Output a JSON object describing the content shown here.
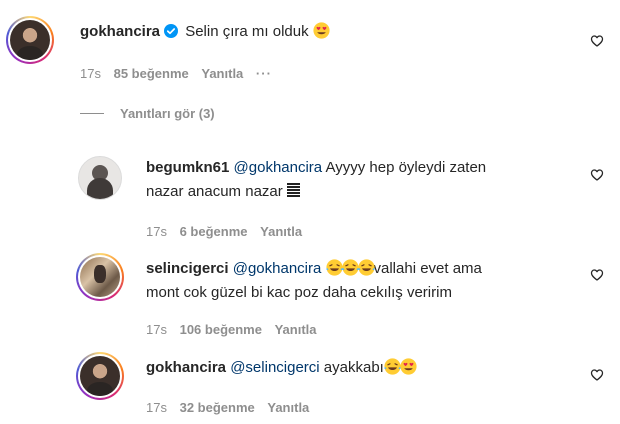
{
  "comments": [
    {
      "username": "gokhancira",
      "verified": true,
      "text": "Selin çıra mı olduk",
      "emoji": "heart-eyes-emoji",
      "time": "17s",
      "likes": "85 beğenme",
      "reply": "Yanıtla",
      "more": "···"
    }
  ],
  "view_replies": "Yanıtları gör (3)",
  "replies": [
    {
      "username": "begumkn61",
      "mention": "@gokhancira",
      "text_line1": "Ayyyy hep öyleydi zaten",
      "text_line2": "nazar anacum nazar",
      "time": "17s",
      "likes": "6 beğenme",
      "reply": "Yanıtla"
    },
    {
      "username": "selincigerci",
      "mention": "@gokhancira",
      "text_line1": "vallahi evet ama",
      "text_line2": "mont cok güzel bi kac poz daha cekılış veririm",
      "time": "17s",
      "likes": "106 beğenme",
      "reply": "Yanıtla"
    },
    {
      "username": "gokhancira",
      "mention": "@selincigerci",
      "text_line1": "ayakkabı",
      "time": "17s",
      "likes": "32 beğenme",
      "reply": "Yanıtla"
    }
  ],
  "colors": {
    "text": "#262626",
    "secondary": "#8e8e8e",
    "mention": "#00376b",
    "verified": "#0095f6"
  }
}
